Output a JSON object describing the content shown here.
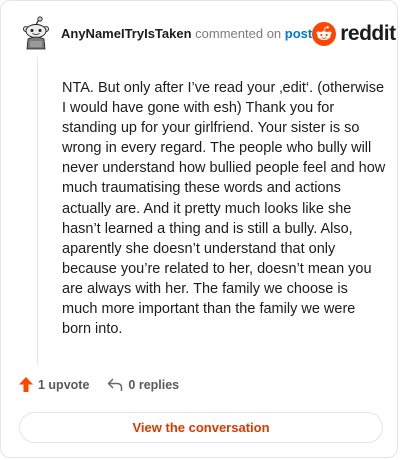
{
  "comment": {
    "username": "AnyNameITryIsTaken",
    "action_text": "commented on",
    "post_link_text": "post",
    "body": "NTA. But only after I’ve read your ‚edit‘. (otherwise I would have gone with esh) Thank you for standing up for your girlfriend. Your sister is so wrong in every regard. The people who bully will never understand how bullied people feel and how much traumatising these words and actions actually are. And it pretty much looks like she hasn’t learned a thing and is still a bully. Also, aparently she doesn’t understand that only because you’re related to her, doesn’t mean you are always with her. The family we choose is much more important than the family we were born into."
  },
  "brand": {
    "name": "reddit",
    "icon": "reddit-logo-icon",
    "color": "#ff4500"
  },
  "actions": {
    "upvote_label": "1 upvote",
    "upvote_icon": "upvote-arrow-icon",
    "upvote_color": "#ff4500",
    "replies_label": "0 replies",
    "replies_icon": "reply-arrow-icon"
  },
  "view_button": {
    "label": "View the conversation",
    "color": "#d93a00"
  },
  "colors": {
    "link": "#0079d3",
    "border": "#e3e5e8",
    "muted": "#7c7c7c"
  }
}
